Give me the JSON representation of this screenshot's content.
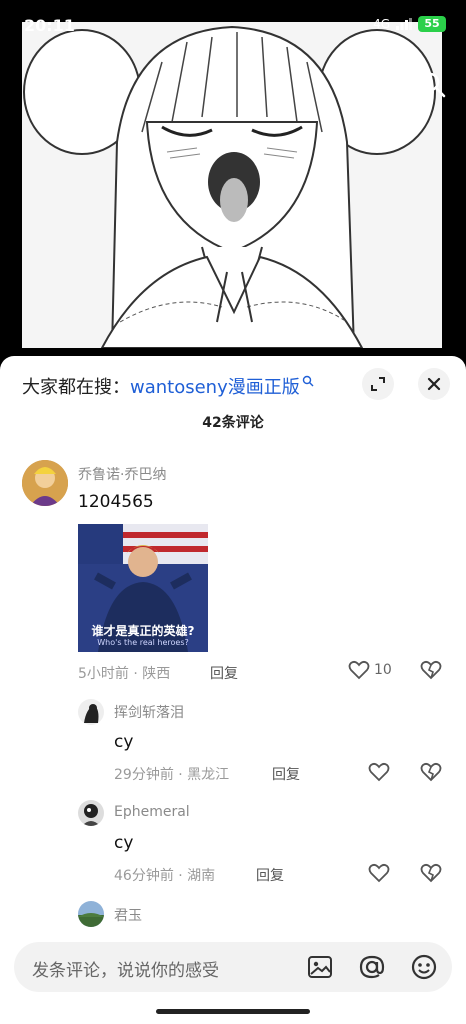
{
  "status_bar": {
    "time": "20:11",
    "signal": "4G",
    "battery": "55"
  },
  "video": {
    "search_icon": "search-icon"
  },
  "sheet": {
    "suggest_prefix": "大家都在搜：",
    "suggest_query": "wantoseny漫画正版",
    "comment_count": "42条评论",
    "expand_icon": "expand-icon",
    "close_icon": "close-icon"
  },
  "comments": [
    {
      "author": "乔鲁诺·乔巴纳",
      "content": "1204565",
      "meme_caption": "谁才是真正的英雄?",
      "meme_subtitle": "Who's the real heroes?",
      "time": "5小时前 · 陕西",
      "reply": "回复",
      "likes": "10"
    },
    {
      "author": "挥剑斩落泪",
      "content": "cy",
      "time": "29分钟前 · 黑龙江",
      "reply": "回复"
    },
    {
      "author": "Ephemeral",
      "content": "cy",
      "time": "46分钟前 · 湖南",
      "reply": "回复"
    },
    {
      "author": "君玉"
    }
  ],
  "input_bar": {
    "placeholder": "发条评论，说说你的感受",
    "icons": [
      "image-icon",
      "at-icon",
      "emoji-icon"
    ]
  },
  "colors": {
    "link_blue": "#1f5fd6",
    "meta_gray": "#9a9a9a",
    "battery_green": "#2bd04a"
  }
}
